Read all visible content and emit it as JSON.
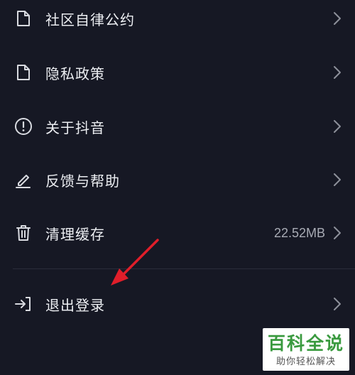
{
  "settings": {
    "items": [
      {
        "label": "社区自律公约",
        "icon": "document-icon"
      },
      {
        "label": "隐私政策",
        "icon": "document-icon"
      },
      {
        "label": "关于抖音",
        "icon": "info-circle-icon"
      },
      {
        "label": "反馈与帮助",
        "icon": "edit-pencil-icon"
      },
      {
        "label": "清理缓存",
        "icon": "trash-icon",
        "value": "22.52MB"
      },
      {
        "label": "退出登录",
        "icon": "logout-icon"
      }
    ]
  },
  "annotation": {
    "arrow_color": "#e01e2a"
  },
  "watermark": {
    "title": "百科全说",
    "subtitle": "助你轻松解决"
  },
  "colors": {
    "background": "#161824",
    "text": "#eceef2",
    "muted": "#a8abb4"
  }
}
